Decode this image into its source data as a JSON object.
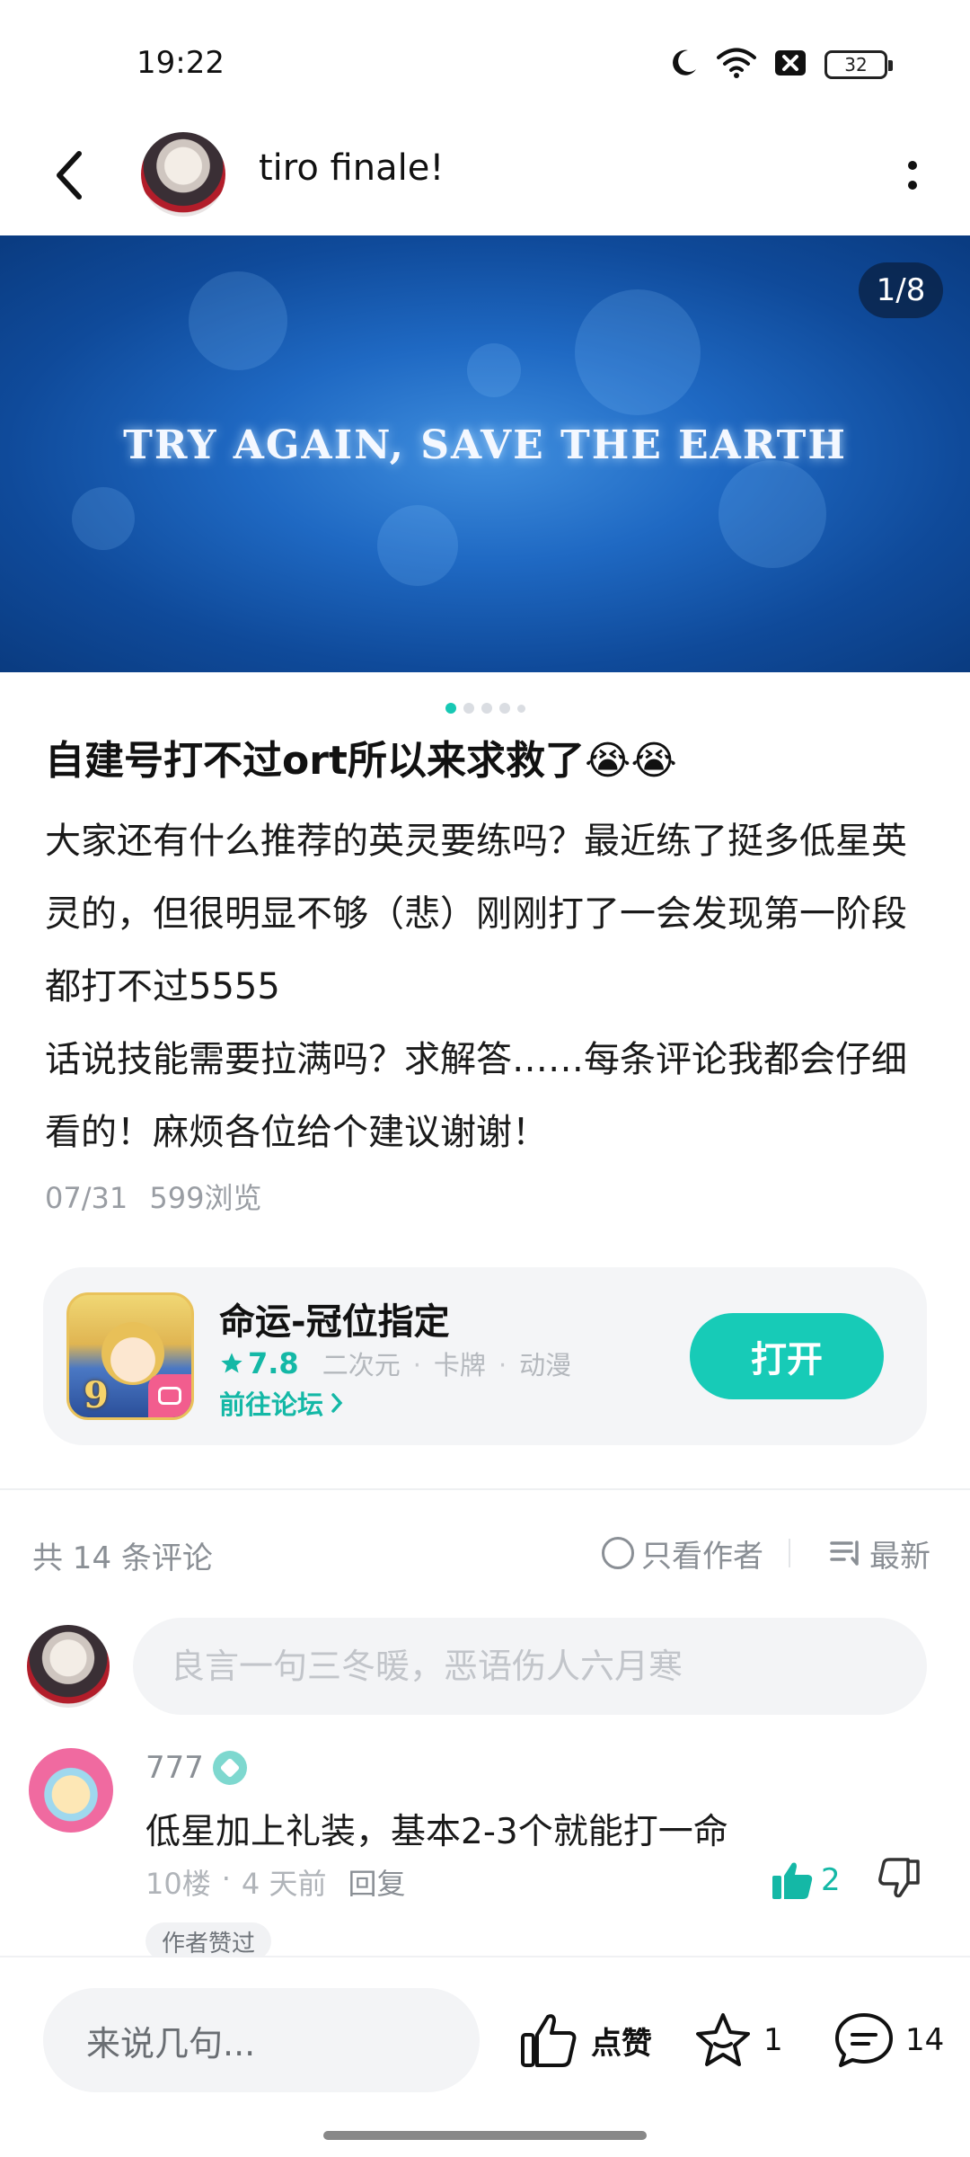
{
  "status_bar": {
    "time": "19:22",
    "battery": "32",
    "icons": [
      "moon-icon",
      "wifi-icon",
      "sim-off-icon",
      "battery-icon"
    ]
  },
  "header": {
    "title": "tiro finale!",
    "icons": [
      "back-arrow-icon",
      "more-vertical-icon"
    ]
  },
  "banner": {
    "text": "TRY AGAIN, SAVE THE EARTH",
    "counter": "1/8",
    "total_pages": 8,
    "current_page": 1
  },
  "post": {
    "title": "自建号打不过ort所以来求救了😭😭",
    "body_lines": [
      "大家还有什么推荐的英灵要练吗？最近练了挺多低星英灵的，但很明显不够（悲）刚刚打了一会发现第一阶段都打不过5555",
      "话说技能需要拉满吗？求解答……每条评论我都会仔细看的！麻烦各位给个建议谢谢！"
    ],
    "date": "07/31",
    "views": "599浏览"
  },
  "game_card": {
    "name": "命运-冠位指定",
    "rating": "7.8",
    "tags": [
      "二次元",
      "卡牌",
      "动漫"
    ],
    "forum_link": "前往论坛",
    "open_button": "打开",
    "accent_color": "#17cbb7"
  },
  "comments_section": {
    "count_label": "共 14 条评论",
    "only_author_label": "只看作者",
    "sort_label": "最新",
    "input_placeholder": "良言一句三冬暖，恶语伤人六月寒"
  },
  "comments": [
    {
      "user": "777",
      "text": "低星加上礼装，基本2-3个就能打一命",
      "floor": "10楼",
      "time": "4 天前",
      "reply_label": "回复",
      "likes": "2",
      "tag": "作者赞过"
    }
  ],
  "bottom_bar": {
    "input_placeholder": "来说几句...",
    "like_label": "点赞",
    "favorites": "1",
    "comments": "14"
  }
}
